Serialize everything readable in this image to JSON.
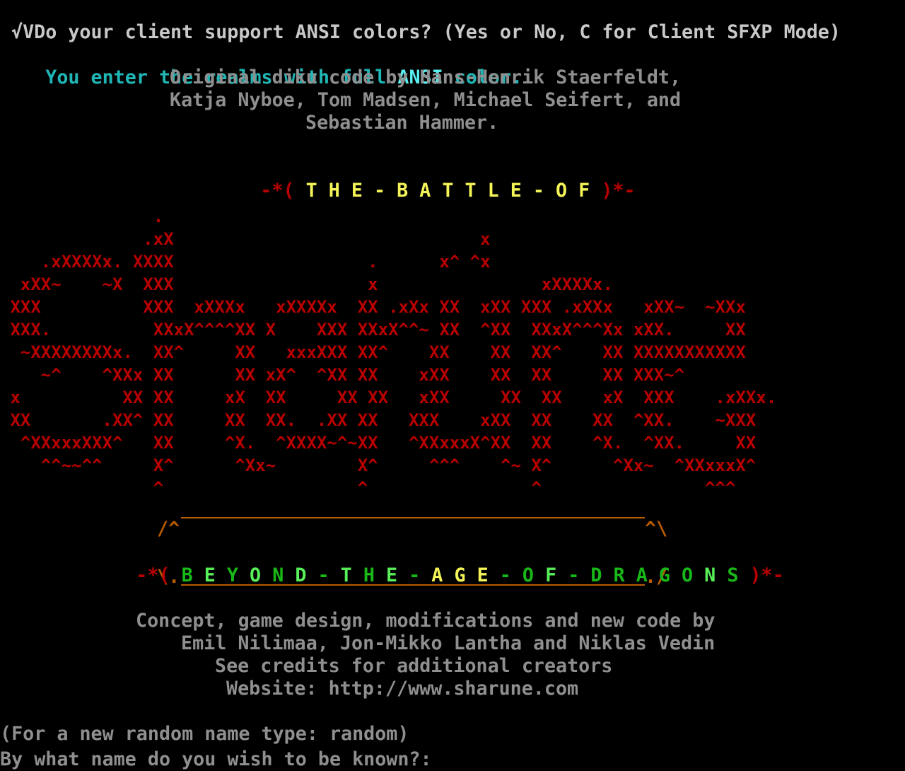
{
  "terminal": {
    "line_ansi_question": "√VDo your client support ANSI colors? (Yes or No, C for Client SFXP Mode)",
    "line_realms_a": "You enter the realms with full ",
    "line_realms_b": "ANSI",
    "line_realms_c": " color.",
    "credits_diku": [
      "Original diku code by Hans-Henrik Staerfeldt,",
      "Katja Nyboe, Tom Madsen, Michael Seifert, and",
      "Sebastian Hammer."
    ],
    "battle_of": {
      "left_deco": "-*(",
      "text": "T H E - B A T T L E - O F",
      "right_deco": ")*-"
    },
    "logo_art": [
      "               .",
      "              .xX                              x",
      "    .xXXXXx. XXXX                   .      x^ ^x",
      "  xXX~    ~X  XXX                   x                xXXXXx.",
      " XXX          XXX  xXXXx   xXXXXx  XX .xXx XX  xXX XXX .xXXx   xXX~  ~XXx",
      " XXX.          XXxX^^^^XX X    XXX XXxX^^~ XX  ^XX  XXxX^^^Xx xXX.     XX",
      "  ~XXXXXXXXx.  XX^     XX   xxxXXX XX^    XX    XX  XX^    XX XXXXXXXXXXX",
      "    ~^    ^XXx XX      XX xX^  ^XX XX    xXX    XX  XX     XX XXX~^",
      " x          XX XX     xX  XX     XX XX   xXX     XX  XX    xX  XXX    .xXXx.",
      " XX       .XX^ XX     XX  XX.  .XX XX   XXX    xXX  XX    XX  ^XX.    ~XXX",
      "  ^XXxxxXXX^   XX     ^X.  ^XXXX~^~XX   ^XXxxxX^XX  XX    ^X.  ^XX.     XX",
      "    ^^~~^^     X^      ^Xx~        X^     ^^^    ^~ X^      ^Xx~  ^XXxxxX^",
      "               ^                   ^                ^                ^^^"
    ],
    "banner_top": "^ ^",
    "beyond": {
      "left_deco": "-*(",
      "words": [
        {
          "t": "B",
          "c": "green"
        },
        {
          "t": "E",
          "c": "green-b"
        },
        {
          "t": "Y",
          "c": "green"
        },
        {
          "t": "O",
          "c": "green-b"
        },
        {
          "t": "N",
          "c": "green"
        },
        {
          "t": "D",
          "c": "green-b"
        },
        {
          "t": "-",
          "c": "green"
        },
        {
          "t": "T",
          "c": "green-b"
        },
        {
          "t": "H",
          "c": "green"
        },
        {
          "t": "E",
          "c": "green-b"
        },
        {
          "t": "-",
          "c": "green"
        },
        {
          "t": "A",
          "c": "yellow"
        },
        {
          "t": "G",
          "c": "yellow"
        },
        {
          "t": "E",
          "c": "yellow"
        },
        {
          "t": "-",
          "c": "green"
        },
        {
          "t": "O",
          "c": "green"
        },
        {
          "t": "F",
          "c": "green-b"
        },
        {
          "t": "-",
          "c": "green"
        },
        {
          "t": "D",
          "c": "green"
        },
        {
          "t": "R",
          "c": "green"
        },
        {
          "t": "A",
          "c": "green"
        },
        {
          "t": "G",
          "c": "green"
        },
        {
          "t": "O",
          "c": "green"
        },
        {
          "t": "N",
          "c": "green-b"
        },
        {
          "t": "S",
          "c": "green"
        }
      ],
      "right_deco": ")*-"
    },
    "credits_game": [
      "Concept, game design, modifications and new code by",
      "Emil Nilimaa, Jon-Mikko Lantha and Niklas Vedin",
      "See credits for additional creators",
      "Website: http://www.sharune.com"
    ],
    "random_hint": "(For a new random name type: random)",
    "name_prompt": "By what name do you wish to be known?:"
  },
  "colors": {
    "background": "#000000",
    "logo": "#b80000",
    "cyan": "#20b6b6",
    "grey": "#8f8f8f",
    "yellow": "#f4f458",
    "green": "#18b818"
  }
}
